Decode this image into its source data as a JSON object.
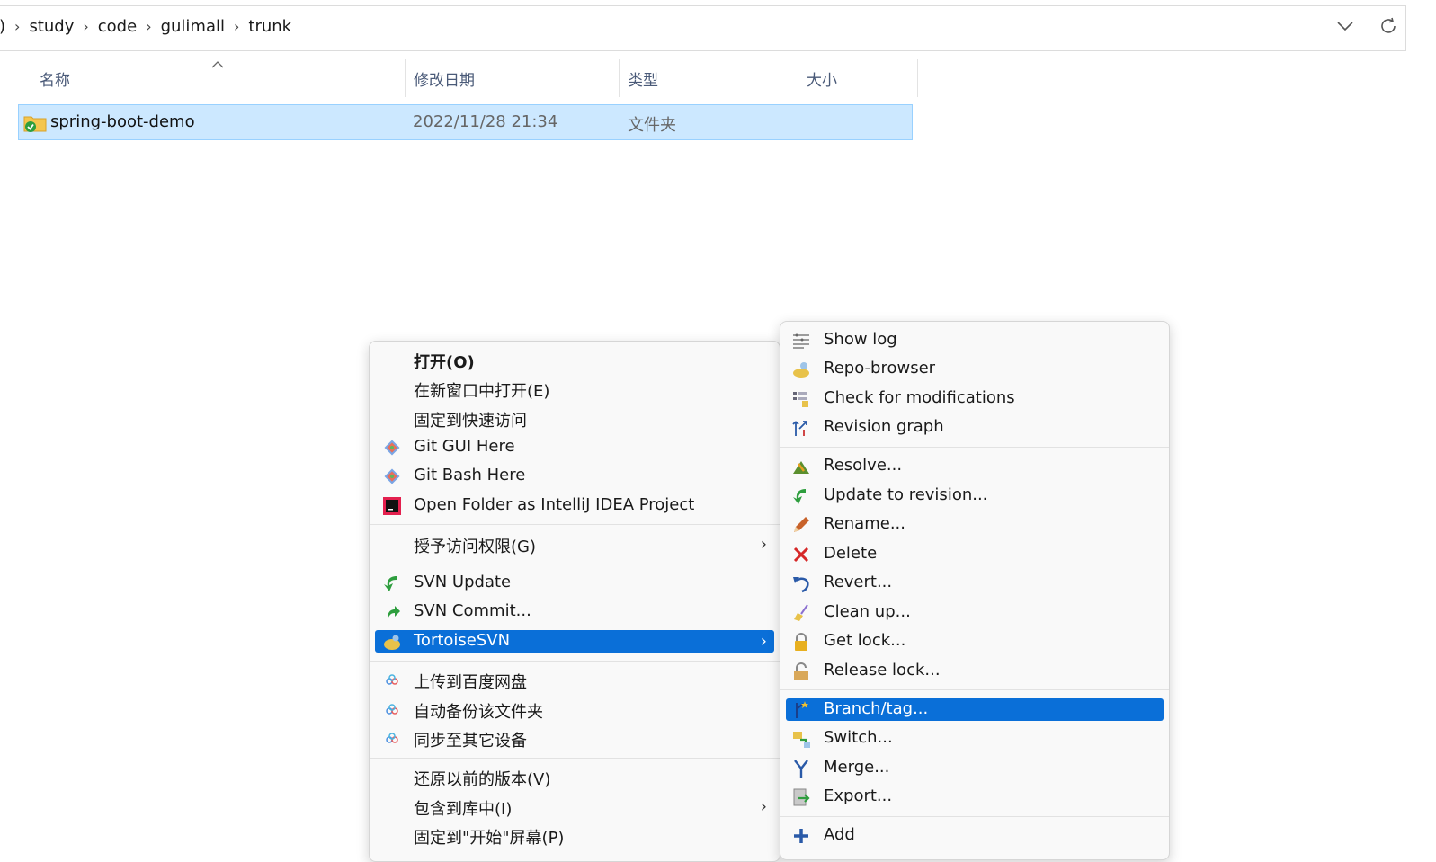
{
  "address": {
    "lead": ")",
    "crumbs": [
      "study",
      "code",
      "gulimall",
      "trunk"
    ],
    "sep": "›"
  },
  "columns": {
    "name": "名称",
    "date": "修改日期",
    "type": "类型",
    "size": "大小"
  },
  "file": {
    "name": "spring-boot-demo",
    "date": "2022/11/28 21:34",
    "type": "文件夹"
  },
  "menu1": {
    "items": [
      {
        "label": "打开(O)"
      },
      {
        "label": "在新窗口中打开(E)"
      },
      {
        "label": "固定到快速访问"
      },
      {
        "label": "Git GUI Here"
      },
      {
        "label": "Git Bash Here"
      },
      {
        "label": "Open Folder as IntelliJ IDEA Project"
      },
      {
        "label": "授予访问权限(G)"
      },
      {
        "label": "SVN Update"
      },
      {
        "label": "SVN Commit..."
      },
      {
        "label": "TortoiseSVN"
      },
      {
        "label": "上传到百度网盘"
      },
      {
        "label": "自动备份该文件夹"
      },
      {
        "label": "同步至其它设备"
      },
      {
        "label": "还原以前的版本(V)"
      },
      {
        "label": "包含到库中(I)"
      },
      {
        "label": "固定到\"开始\"屏幕(P)"
      }
    ],
    "arrow": "›"
  },
  "menu2": {
    "items": [
      {
        "label": "Show log"
      },
      {
        "label": "Repo-browser"
      },
      {
        "label": "Check for modifications"
      },
      {
        "label": "Revision graph"
      },
      {
        "label": "Resolve..."
      },
      {
        "label": "Update to revision..."
      },
      {
        "label": "Rename..."
      },
      {
        "label": "Delete"
      },
      {
        "label": "Revert..."
      },
      {
        "label": "Clean up..."
      },
      {
        "label": "Get lock..."
      },
      {
        "label": "Release lock..."
      },
      {
        "label": "Branch/tag..."
      },
      {
        "label": "Switch..."
      },
      {
        "label": "Merge..."
      },
      {
        "label": "Export..."
      },
      {
        "label": "Add"
      }
    ]
  },
  "colors": {
    "selection": "#cce8ff",
    "menu_highlight": "#0a6fd8"
  }
}
